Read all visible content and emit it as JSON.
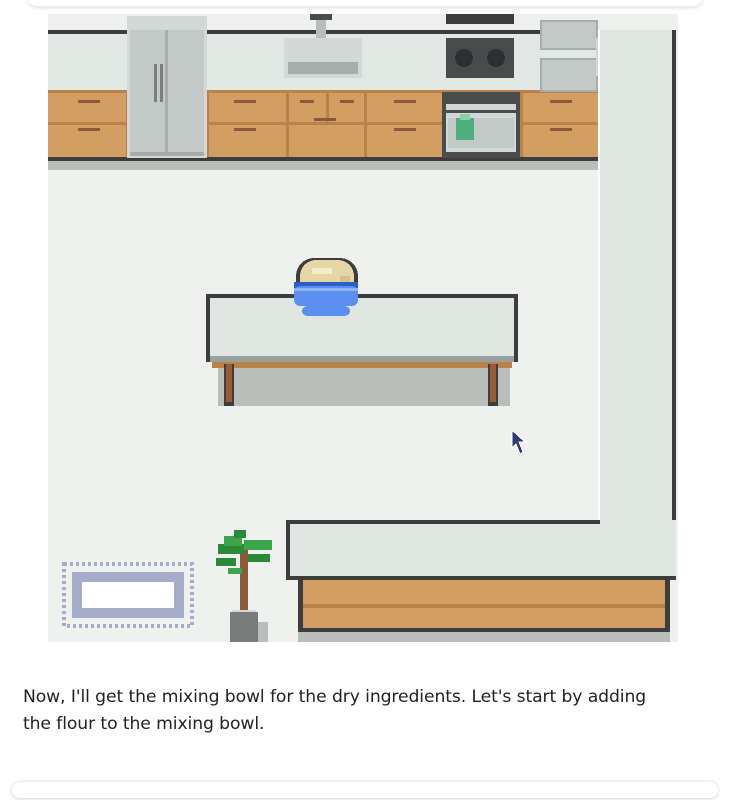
{
  "game": {
    "scene_name": "kitchen",
    "caption_lines": [
      "Now, I'll get the mixing bowl for the dry ingredients. Let's start by adding",
      "the flour to the mixing bowl."
    ],
    "character": {
      "hair": "blonde",
      "holding": "mixing-bowl"
    },
    "colors": {
      "floor": "#eef1ee",
      "wall": "#e1e8e3",
      "counter_top": "#dfe6e1",
      "outline": "#3d3d3d",
      "cabinet": "#d39e62",
      "cabinet_dark": "#b9824a",
      "appliance": "#c3c9c7",
      "stove": "#4a4b4c",
      "bowl": "#5b8fef",
      "hair": "#e6d6a6",
      "plant": "#3aa54a",
      "rug": "#a4acc8",
      "table_leg": "#9a5a37"
    }
  }
}
